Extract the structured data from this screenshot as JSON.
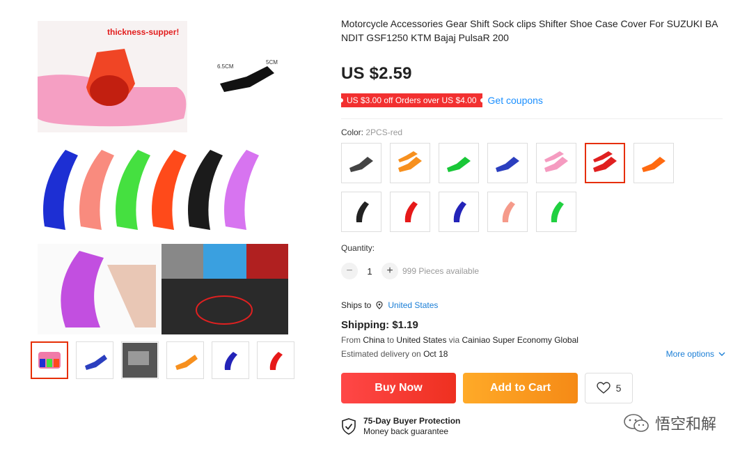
{
  "product": {
    "title": "Motorcycle Accessories Gear Shift Sock clips Shifter Shoe Case Cover For SUZUKI BANDIT GSF1250 KTM Bajaj PulsaR 200",
    "price": "US $2.59",
    "coupon_text": "US $3.00 off Orders over US $4.00",
    "get_coupons": "Get coupons",
    "image_caption": "thickness-supper!",
    "dim_a": "6.5CM",
    "dim_b": "5CM"
  },
  "color": {
    "label": "Color:",
    "selected": "2PCS-red",
    "swatches": [
      {
        "color": "#444444"
      },
      {
        "color": "#f7901e"
      },
      {
        "color": "#19c738"
      },
      {
        "color": "#2b3fbf"
      },
      {
        "color": "#f59bc0"
      },
      {
        "color": "#e02020"
      },
      {
        "color": "#ff6a10"
      },
      {
        "color": "#222222"
      },
      {
        "color": "#e61919"
      },
      {
        "color": "#2323b8"
      },
      {
        "color": "#f59a8a"
      },
      {
        "color": "#20d040"
      }
    ],
    "selected_index": 5
  },
  "quantity": {
    "label": "Quantity:",
    "minus": "−",
    "plus": "+",
    "value": "1",
    "available": "999 Pieces available"
  },
  "shipping": {
    "ships_to_label": "Ships to",
    "ships_to": "United States",
    "cost": "Shipping: $1.19",
    "from_prefix": "From",
    "from": "China",
    "to_prefix": "to",
    "to": "United States",
    "via_prefix": "via",
    "via": "Cainiao Super Economy Global",
    "delivery_prefix": "Estimated delivery on",
    "delivery_date": "Oct 18",
    "more_options": "More options"
  },
  "actions": {
    "buy_now": "Buy Now",
    "add_to_cart": "Add to Cart",
    "wishlist_count": "5"
  },
  "protection": {
    "title": "75-Day Buyer Protection",
    "subtitle": "Money back guarantee"
  },
  "watermark": {
    "text": "悟空和解"
  },
  "thumbnails": [
    {
      "color": "#f07aa8"
    },
    {
      "color": "#2b3fbf"
    },
    {
      "color": "#888888"
    },
    {
      "color": "#f7901e"
    },
    {
      "color": "#2323b8"
    },
    {
      "color": "#e61919"
    }
  ]
}
